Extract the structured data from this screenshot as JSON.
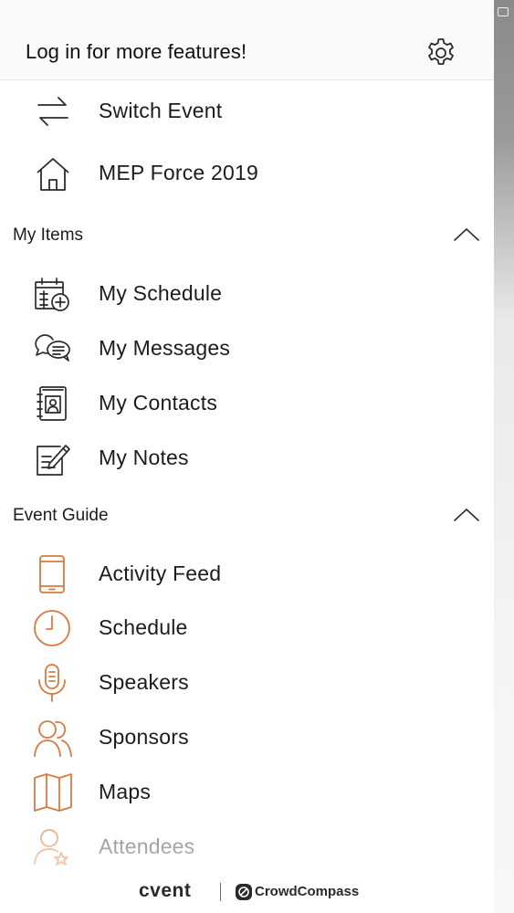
{
  "header": {
    "login_text": "Log in for more features!",
    "settings_icon": "gear-icon"
  },
  "top_items": [
    {
      "label": "Switch Event",
      "icon": "switch-arrows-icon"
    },
    {
      "label": "MEP Force 2019",
      "icon": "home-icon"
    }
  ],
  "my_items": {
    "title": "My Items",
    "expanded": true,
    "items": [
      {
        "label": "My Schedule",
        "icon": "calendar-add-icon"
      },
      {
        "label": "My Messages",
        "icon": "chat-bubbles-icon"
      },
      {
        "label": "My Contacts",
        "icon": "contact-book-icon"
      },
      {
        "label": "My Notes",
        "icon": "note-pencil-icon"
      }
    ]
  },
  "event_guide": {
    "title": "Event Guide",
    "expanded": true,
    "items": [
      {
        "label": "Activity Feed",
        "icon": "phone-icon"
      },
      {
        "label": "Schedule",
        "icon": "clock-icon"
      },
      {
        "label": "Speakers",
        "icon": "microphone-icon"
      },
      {
        "label": "Sponsors",
        "icon": "people-icon"
      },
      {
        "label": "Maps",
        "icon": "map-icon"
      },
      {
        "label": "Attendees",
        "icon": "person-star-icon"
      }
    ]
  },
  "footer": {
    "brand_left": "cvent",
    "brand_right": "CrowdCompass"
  },
  "colors": {
    "accent": "#d9793f",
    "icon_dark": "#2b2b2b",
    "header_bg": "#fbf9fb"
  }
}
